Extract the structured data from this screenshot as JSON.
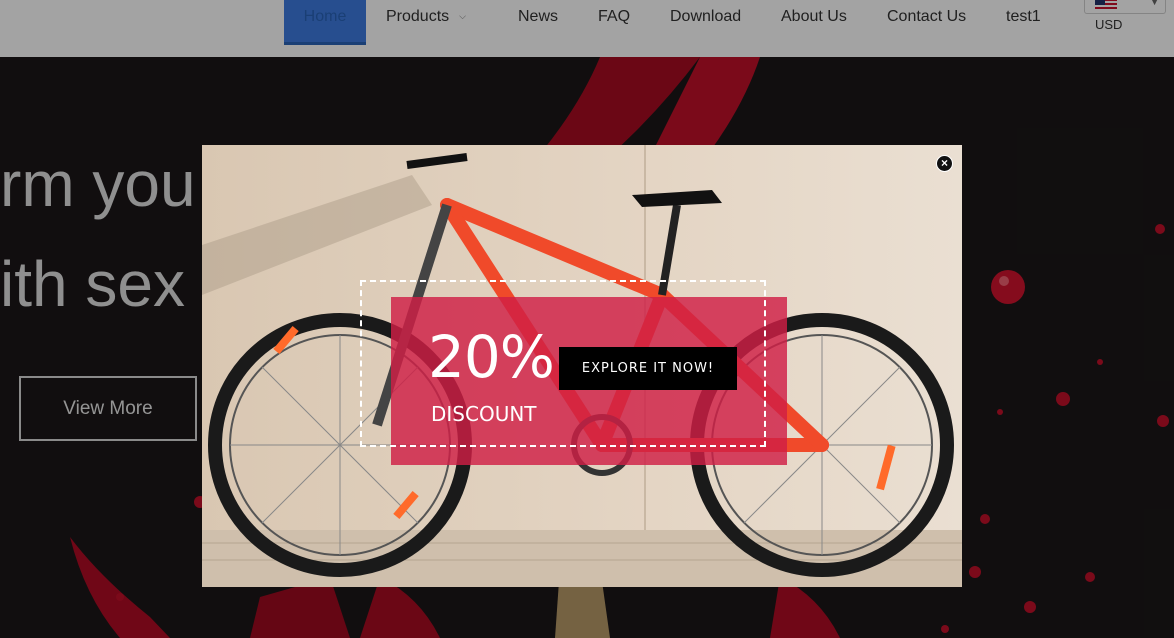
{
  "nav": {
    "items": [
      {
        "label": "Home",
        "active": true
      },
      {
        "label": "Products",
        "has_dropdown": true
      },
      {
        "label": "News"
      },
      {
        "label": "FAQ"
      },
      {
        "label": "Download"
      },
      {
        "label": "About Us"
      },
      {
        "label": "Contact Us"
      },
      {
        "label": "test1"
      }
    ],
    "currency": {
      "flag_icon": "us-flag-icon",
      "code": "USD"
    }
  },
  "hero": {
    "line1": "rm you",
    "line2": "ith sex",
    "cta_label": "View More"
  },
  "popup": {
    "close_icon": "close-icon",
    "discount_value": "20%",
    "discount_label": "DISCOUNT",
    "cta_label": "EXPLORE IT NOW!"
  },
  "colors": {
    "active_nav": "#3d7be0",
    "promo_box": "#d01e46",
    "hero_bg": "#1b1718",
    "splash_red": "#c0102a"
  }
}
